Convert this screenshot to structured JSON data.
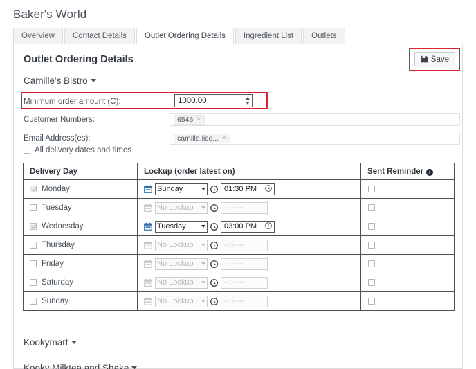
{
  "app": {
    "title": "Baker's World"
  },
  "tabs": [
    {
      "label": "Overview",
      "active": false
    },
    {
      "label": "Contact Details",
      "active": false
    },
    {
      "label": "Outlet Ordering Details",
      "active": true
    },
    {
      "label": "Ingredient List",
      "active": false
    },
    {
      "label": "Outlets",
      "active": false
    }
  ],
  "panel": {
    "section_title": "Outlet Ordering Details",
    "save_label": "Save",
    "save_icon": "floppy-disk-icon",
    "highlight_color": "#d9232d"
  },
  "outlets": [
    {
      "name": "Camille's Bistro",
      "expanded": true
    },
    {
      "name": "Kookymart",
      "expanded": false
    },
    {
      "name": "Kooky Milktea and Shake",
      "expanded": false
    }
  ],
  "form": {
    "min_order_label": "Minimum order amount (₵):",
    "min_order_value": "1000.00",
    "customer_numbers_label": "Customer Numbers:",
    "customer_numbers_tags": [
      "6546"
    ],
    "email_label": "Email Address(es):",
    "email_tags": [
      "camille.lico..."
    ],
    "all_dates_label": "All delivery dates and times",
    "all_dates_checked": false,
    "tag_remove_icon": "close-icon"
  },
  "table": {
    "headers": {
      "day": "Delivery Day",
      "lockup": "Lockup (order latest on)",
      "reminder": "Sent Reminder",
      "reminder_info_icon": "info-icon"
    },
    "empty_time": "--:-- --",
    "no_lockup": "No Lockup",
    "calendar_icon": "calendar-icon",
    "clock_icon": "clock-icon",
    "rows": [
      {
        "day": "Monday",
        "checked": true,
        "lockup_day": "Sunday",
        "lockup_time": "01:30 PM",
        "enabled": true,
        "reminder": false
      },
      {
        "day": "Tuesday",
        "checked": false,
        "lockup_day": "No Lockup",
        "lockup_time": "--:-- --",
        "enabled": false,
        "reminder": false
      },
      {
        "day": "Wednesday",
        "checked": true,
        "lockup_day": "Tuesday",
        "lockup_time": "03:00 PM",
        "enabled": true,
        "reminder": false
      },
      {
        "day": "Thursday",
        "checked": false,
        "lockup_day": "No Lockup",
        "lockup_time": "--:-- --",
        "enabled": false,
        "reminder": false
      },
      {
        "day": "Friday",
        "checked": false,
        "lockup_day": "No Lockup",
        "lockup_time": "--:-- --",
        "enabled": false,
        "reminder": false
      },
      {
        "day": "Saturday",
        "checked": false,
        "lockup_day": "No Lockup",
        "lockup_time": "--:-- --",
        "enabled": false,
        "reminder": false
      },
      {
        "day": "Sunday",
        "checked": false,
        "lockup_day": "No Lockup",
        "lockup_time": "--:-- --",
        "enabled": false,
        "reminder": false
      }
    ]
  }
}
